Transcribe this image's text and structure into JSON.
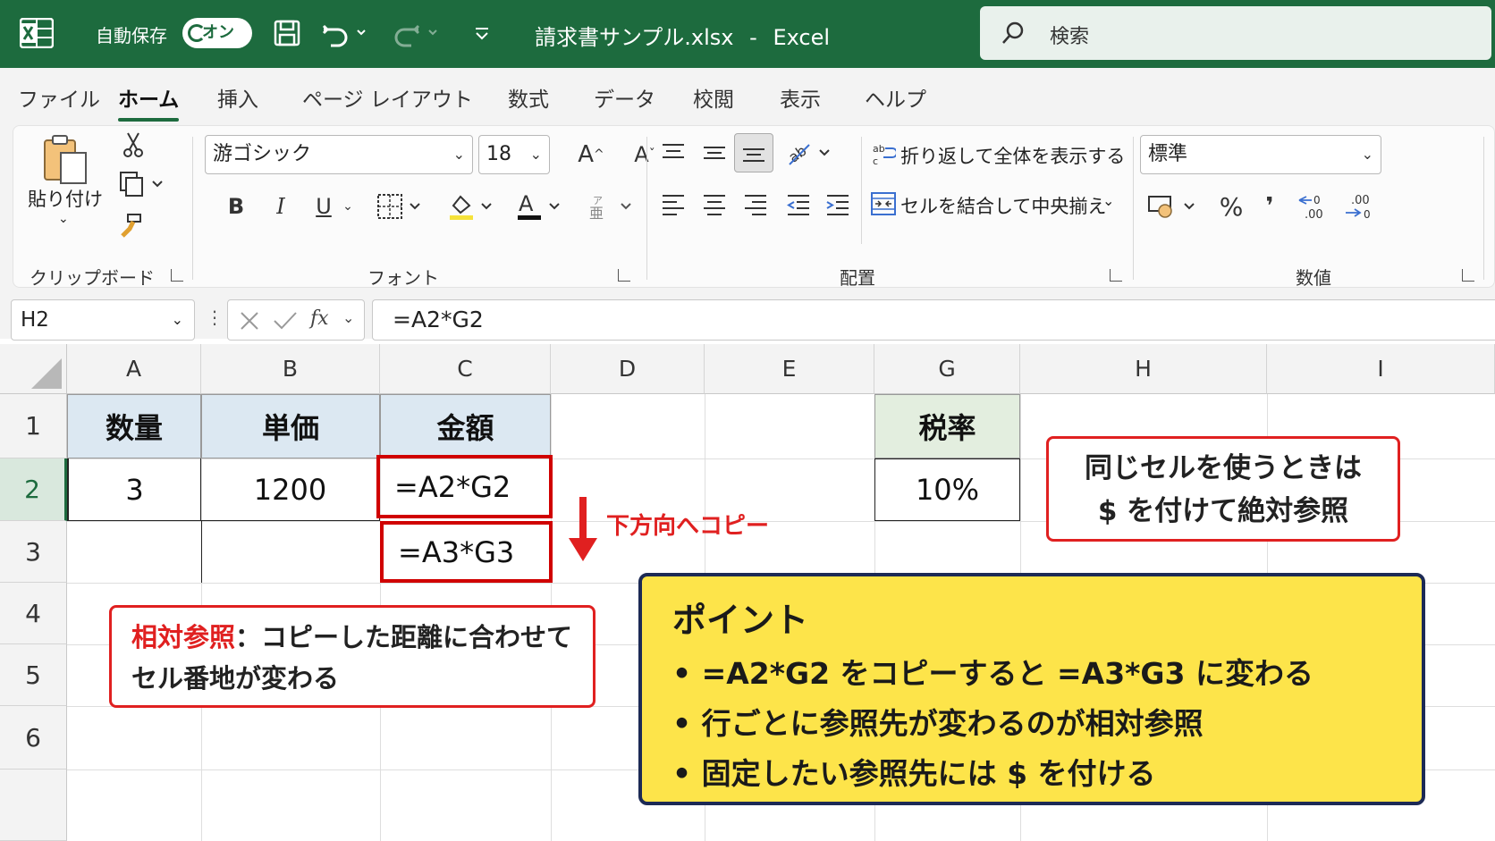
{
  "titlebar": {
    "autosave_label": "自動保存",
    "autosave_state": "オン",
    "filename": "請求書サンプル.xlsx",
    "separator": "-",
    "app_name": "Excel",
    "search_placeholder": "検索"
  },
  "tabs": [
    {
      "label": "ファイル",
      "active": false
    },
    {
      "label": "ホーム",
      "active": true
    },
    {
      "label": "挿入",
      "active": false
    },
    {
      "label": "ページ レイアウト",
      "active": false
    },
    {
      "label": "数式",
      "active": false
    },
    {
      "label": "データ",
      "active": false
    },
    {
      "label": "校閲",
      "active": false
    },
    {
      "label": "表示",
      "active": false
    },
    {
      "label": "ヘルプ",
      "active": false
    }
  ],
  "ribbon": {
    "clipboard": {
      "paste_label": "貼り付け",
      "group_label": "クリップボード"
    },
    "font": {
      "font_name": "游ゴシック",
      "font_size": "18",
      "group_label": "フォント",
      "bold": "B",
      "italic": "I",
      "underline": "U"
    },
    "alignment": {
      "wrap_text": "折り返して全体を表示する",
      "merge_center": "セルを結合して中央揃え",
      "group_label": "配置"
    },
    "number": {
      "format": "標準",
      "percent": "%",
      "comma": "❜",
      "group_label": "数値"
    }
  },
  "formula_bar": {
    "name_box": "H2",
    "fx": "fx",
    "formula": "=A2*G2"
  },
  "grid": {
    "columns": [
      "A",
      "B",
      "C",
      "D",
      "E",
      "G",
      "H",
      "I"
    ],
    "rows": [
      "1",
      "2",
      "3",
      "4",
      "5",
      "6"
    ],
    "cells": {
      "A1": "数量",
      "B1": "単価",
      "C1": "金額",
      "A2": "3",
      "B2": "1200",
      "C2": "=A2*G2",
      "C3": "=A3*G3",
      "G1": "税率",
      "G2": "10%"
    }
  },
  "annotations": {
    "copy_down": "下方向へコピー",
    "absolute_note": {
      "line1": "同じセルを使うときは",
      "line2": "$ を付けて絶対参照"
    },
    "relative_note": {
      "term": "相対参照",
      "line1_rest": "：コピーした距離に合わせて",
      "line2": "セル番地が変わる"
    },
    "point": {
      "title": "ポイント",
      "items": [
        "• =A2*G2 をコピーすると =A3*G3 に変わる",
        "• 行ごとに参照先が変わるのが相対参照",
        "• 固定したい参照先には $ を付ける"
      ]
    }
  },
  "colors": {
    "excel_green": "#1d6b3e",
    "callout_red": "#e02020",
    "point_yellow": "#fde44a",
    "point_border": "#1c2a55"
  }
}
